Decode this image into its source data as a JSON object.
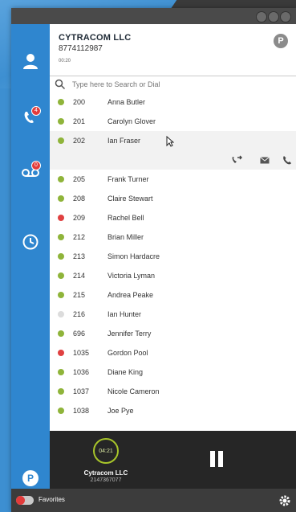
{
  "header": {
    "company": "CYTRACOM LLC",
    "phone": "8774112987",
    "timer": "00:20",
    "presence_badge": "P"
  },
  "search": {
    "placeholder": "Type here to Search or Dial"
  },
  "sidebar": {
    "items": [
      {
        "icon": "user-icon"
      },
      {
        "icon": "missed-calls-icon",
        "badge": "4"
      },
      {
        "icon": "voicemail-icon",
        "badge": "0"
      },
      {
        "icon": "history-icon"
      }
    ],
    "logo": "P"
  },
  "contacts": [
    {
      "ext": "200",
      "name": "Anna Butler",
      "status": "green"
    },
    {
      "ext": "201",
      "name": "Carolyn Glover",
      "status": "green"
    },
    {
      "ext": "202",
      "name": "Ian Fraser",
      "status": "green",
      "selected": true
    },
    {
      "ext": "205",
      "name": "Frank Turner",
      "status": "green"
    },
    {
      "ext": "208",
      "name": "Claire Stewart",
      "status": "green"
    },
    {
      "ext": "209",
      "name": "Rachel Bell",
      "status": "red"
    },
    {
      "ext": "212",
      "name": "Brian Miller",
      "status": "green"
    },
    {
      "ext": "213",
      "name": "Simon Hardacre",
      "status": "green"
    },
    {
      "ext": "214",
      "name": "Victoria Lyman",
      "status": "green"
    },
    {
      "ext": "215",
      "name": "Andrea Peake",
      "status": "green"
    },
    {
      "ext": "216",
      "name": "Ian Hunter",
      "status": "gray"
    },
    {
      "ext": "696",
      "name": "Jennifer Terry",
      "status": "green"
    },
    {
      "ext": "1035",
      "name": "Gordon Pool",
      "status": "red"
    },
    {
      "ext": "1036",
      "name": "Diane King",
      "status": "green"
    },
    {
      "ext": "1037",
      "name": "Nicole Cameron",
      "status": "green"
    },
    {
      "ext": "1038",
      "name": "Joe Pye",
      "status": "green"
    }
  ],
  "status_colors": {
    "green": "#8fb43a",
    "red": "#e04040",
    "gray": "#dcdcdc"
  },
  "call": {
    "duration": "04:21",
    "caller_name": "Cytracom LLC",
    "caller_number": "2147367077"
  },
  "bottom": {
    "favorites_label": "Favorites"
  },
  "colors": {
    "sidebar": "#2f86cf",
    "call_panel": "#262626",
    "ring": "#a8c52a"
  }
}
